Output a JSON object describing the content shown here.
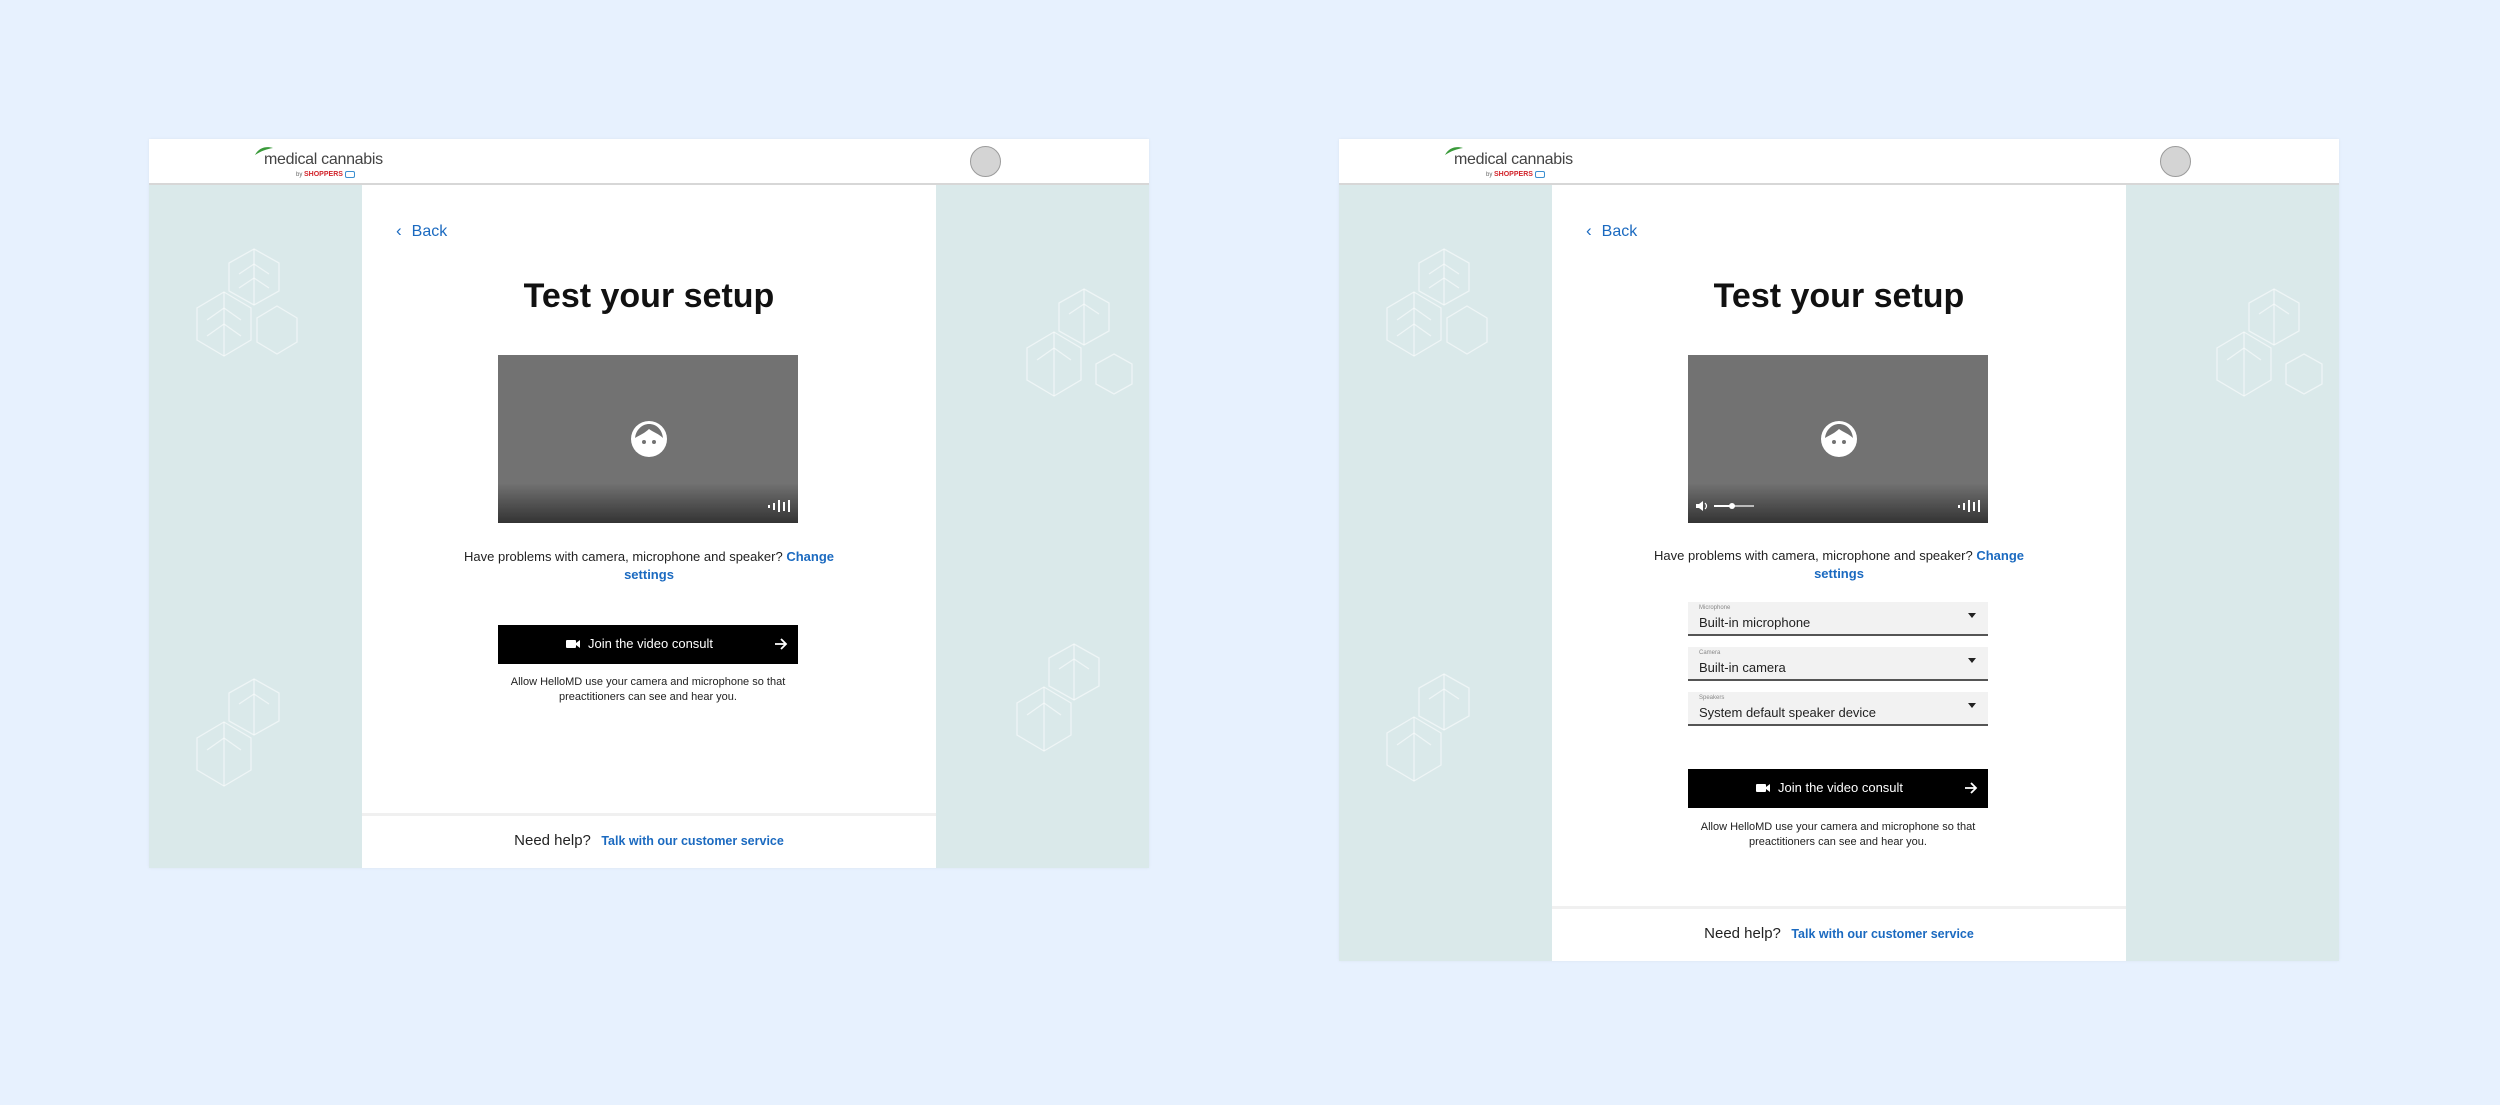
{
  "brand": {
    "name": "medical cannabis",
    "by": "by",
    "partner": "SHOPPERS"
  },
  "screens": [
    {
      "back_label": "Back",
      "title": "Test your setup",
      "problem_text": "Have problems with camera, microphone and speaker?",
      "change_settings_label": "Change settings",
      "join_label": "Join the video consult",
      "allow_text": "Allow HelloMD use your camera and microphone so that preactitioners can see and hear you.",
      "help_question": "Need help?",
      "help_link": "Talk with  our customer service"
    },
    {
      "back_label": "Back",
      "title": "Test your setup",
      "problem_text": "Have problems with camera, microphone and speaker?",
      "change_settings_label": "Change settings",
      "volume_level": 0.45,
      "dropdowns": [
        {
          "label": "Microphone",
          "value": "Built-in microphone"
        },
        {
          "label": "Camera",
          "value": "Built-in camera"
        },
        {
          "label": "Speakers",
          "value": "System default speaker device"
        }
      ],
      "join_label": "Join the video consult",
      "allow_text": "Allow HelloMD use your camera and microphone so that preactitioners can see and hear you.",
      "help_question": "Need help?",
      "help_link": "Talk with  our customer service"
    }
  ],
  "colors": {
    "page_background": "#e7f1fe",
    "side_background": "#dae9ea",
    "link": "#1b6ac0",
    "button": "#000000",
    "video": "#727272"
  },
  "icons": [
    "leaf-logo-icon",
    "chevron-left-icon",
    "face-icon",
    "audio-bars-icon",
    "volume-icon",
    "camera-icon",
    "arrow-right-icon",
    "caret-down-icon"
  ]
}
